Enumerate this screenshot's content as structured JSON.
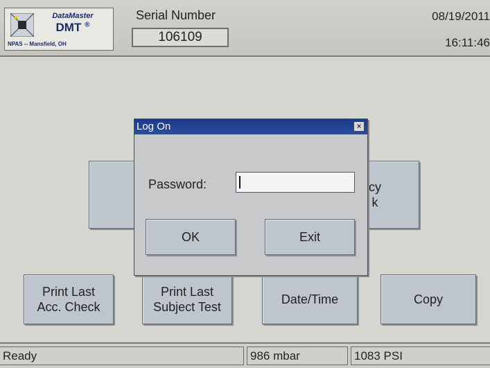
{
  "header": {
    "logo": {
      "title": "DataMaster",
      "name": "DMT",
      "reg": "®",
      "location": "NPAS -- Mansfield, OH"
    },
    "serial_label": "Serial Number",
    "serial_value": "106109",
    "date": "08/19/2011",
    "time": "16:11:46"
  },
  "main": {
    "hidden_left_label": "",
    "hidden_right_label": "cy\nk",
    "buttons": {
      "print_acc": "Print Last\nAcc. Check",
      "print_subject": "Print Last\nSubject Test",
      "datetime": "Date/Time",
      "copy": "Copy"
    }
  },
  "dialog": {
    "title": "Log On",
    "close": "×",
    "password_label": "Password:",
    "password_value": "",
    "ok": "OK",
    "exit": "Exit"
  },
  "status": {
    "ready": "Ready",
    "pressure": "986 mbar",
    "psi": "1083 PSI"
  },
  "colors": {
    "title_bar": "#1a3b85",
    "button_face": "#bfc5cd",
    "brand": "#1a2a6b"
  }
}
